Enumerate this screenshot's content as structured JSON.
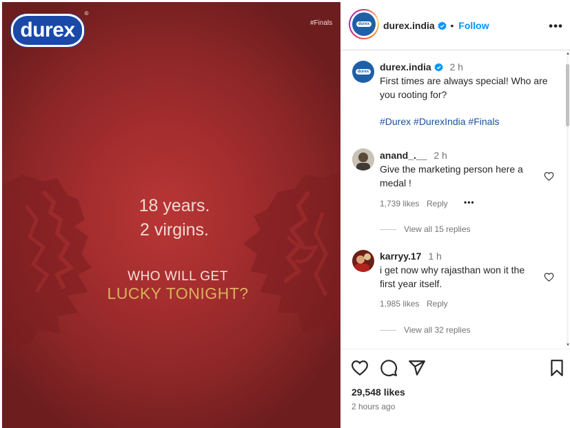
{
  "post_image": {
    "brand_logo": "durex",
    "hashtag": "#Finals",
    "line1": "18 years.",
    "line2": "2 virgins.",
    "question_line1": "WHO WILL GET",
    "question_line2": "LUCKY TONIGHT?",
    "colors": {
      "background": "#a42d2e",
      "gold": "#dbb15f"
    }
  },
  "header": {
    "username": "durex.india",
    "separator": "•",
    "follow_label": "Follow",
    "more_label": "•••"
  },
  "caption": {
    "username": "durex.india",
    "time": "2 h",
    "text_line1": "First times are always special! Who are",
    "text_line2": "you rooting for?",
    "hashtags": [
      "#Durex",
      "#DurexIndia",
      "#Finals"
    ]
  },
  "comments": [
    {
      "username": "anand_.__",
      "time": "2 h",
      "text_line1": "Give the marketing person here a",
      "text_line2": "medal !",
      "likes": "1,739 likes",
      "reply_label": "Reply",
      "more_label": "•••",
      "view_replies": "View all 15 replies"
    },
    {
      "username": "karryy.17",
      "time": "1 h",
      "text_line1": "i get now why rajasthan won it the",
      "text_line2": "first year itself.",
      "likes": "1,985 likes",
      "reply_label": "Reply",
      "view_replies": "View all 32 replies"
    }
  ],
  "footer": {
    "likes": "29,548 likes",
    "time_ago": "2 hours ago"
  },
  "icons": {
    "like": "heart-icon",
    "comment": "comment-icon",
    "share": "share-icon",
    "save": "bookmark-icon",
    "verified": "verified-badge-icon"
  },
  "colors": {
    "link_blue": "#0095f6",
    "text": "#262626",
    "muted": "#737373",
    "verified": "#0095f6"
  }
}
